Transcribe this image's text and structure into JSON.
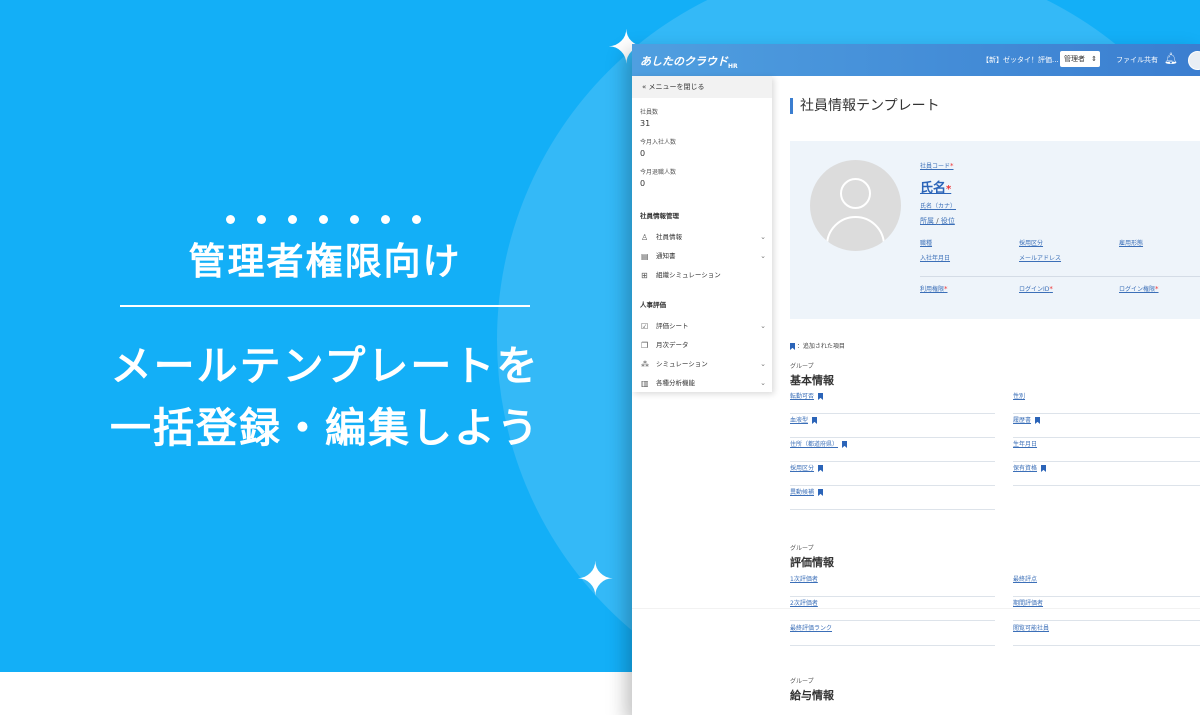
{
  "promo": {
    "badge": "管理者権限向け",
    "line1": "メールテンプレートを",
    "line2": "一括登録・編集しよう"
  },
  "app": {
    "logo": "あしたのクラウド",
    "logo_sub": "HR",
    "notice": "【新】ゼッタイ！評価...",
    "role": "管理者",
    "share": "ファイル共有",
    "sidebar": {
      "close": "メニューを閉じる",
      "stats": [
        {
          "label": "社員数",
          "value": "31"
        },
        {
          "label": "今月入社人数",
          "value": "0"
        },
        {
          "label": "今月退職人数",
          "value": "0"
        }
      ],
      "sections": [
        {
          "title": "社員情報管理",
          "items": [
            {
              "label": "社員情報",
              "icon": "person-icon",
              "chevron": true
            },
            {
              "label": "通知書",
              "icon": "document-icon",
              "chevron": true
            },
            {
              "label": "組織シミュレーション",
              "icon": "org-chart-icon",
              "chevron": false
            }
          ]
        },
        {
          "title": "人事評価",
          "items": [
            {
              "label": "評価シート",
              "icon": "checklist-icon",
              "chevron": true
            },
            {
              "label": "月次データ",
              "icon": "copy-icon",
              "chevron": false
            },
            {
              "label": "シミュレーション",
              "icon": "nodes-icon",
              "chevron": true
            },
            {
              "label": "各種分析機能",
              "icon": "bar-chart-icon",
              "chevron": true
            }
          ]
        }
      ]
    },
    "main": {
      "title": "社員情報テンプレート",
      "card": {
        "code": "社員コード",
        "name": "氏名",
        "kana": "氏名（カナ）",
        "dept": "所属",
        "sep": "/",
        "position": "役位",
        "job": "職種",
        "hire_type": "採用区分",
        "emp_type": "雇用形態",
        "join_date": "入社年月日",
        "email": "メールアドレス",
        "permission": "利用権限",
        "login_id": "ログインID",
        "login_perm": "ログイン権限"
      },
      "legend": "：追加された項目",
      "groups": [
        {
          "label": "グループ",
          "title": "基本情報",
          "fields": [
            {
              "label": "転勤可否",
              "bookmark": true
            },
            {
              "label": "性別",
              "bookmark": false
            },
            {
              "label": "血液型",
              "bookmark": true
            },
            {
              "label": "履歴書",
              "bookmark": true
            },
            {
              "label": "住所（都道府県）",
              "bookmark": true
            },
            {
              "label": "生年月日",
              "bookmark": false
            },
            {
              "label": "採用区分",
              "bookmark": true
            },
            {
              "label": "保有資格",
              "bookmark": true
            },
            {
              "label": "異動候補",
              "bookmark": true
            }
          ]
        },
        {
          "label": "グループ",
          "title": "評価情報",
          "fields": [
            {
              "label": "1次評価者",
              "bookmark": false
            },
            {
              "label": "最終評点",
              "bookmark": false
            },
            {
              "label": "2次評価者",
              "bookmark": false
            },
            {
              "label": "期間評価者",
              "bookmark": false
            },
            {
              "label": "最終評価ランク",
              "bookmark": false
            },
            {
              "label": "閲覧可能社員",
              "bookmark": false
            }
          ]
        },
        {
          "label": "グループ",
          "title": "給与情報"
        }
      ]
    }
  }
}
